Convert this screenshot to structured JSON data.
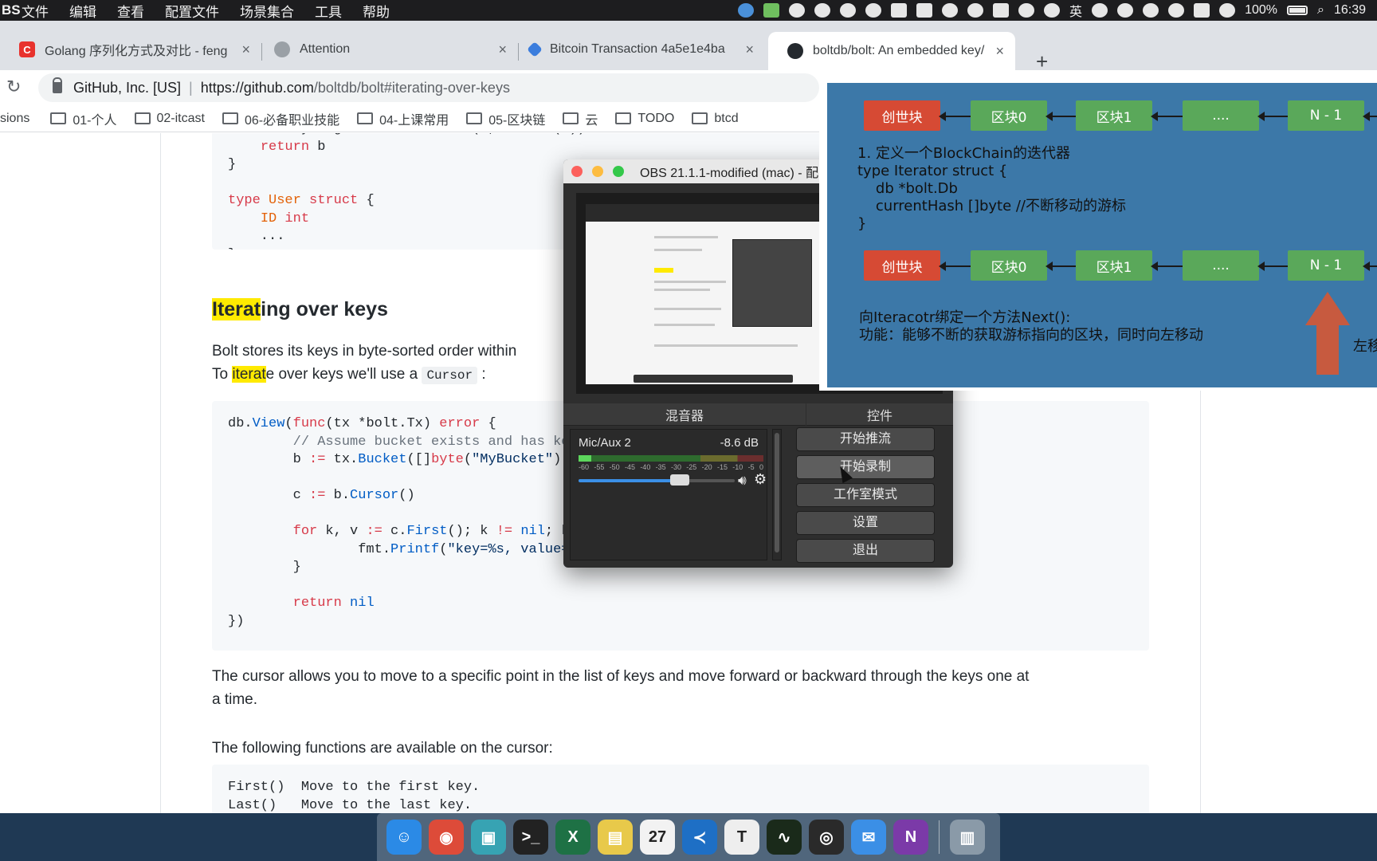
{
  "menubar": {
    "app_name": "BS",
    "menus": [
      "文件",
      "编辑",
      "查看",
      "配置文件",
      "场景集合",
      "工具",
      "帮助"
    ],
    "battery": "100%",
    "ime": "英",
    "clock": "16:39"
  },
  "tabs": [
    {
      "title": "Golang 序列化方式及对比 - feng",
      "favicon": "C",
      "favicon_color": "#e8322d"
    },
    {
      "title": "Attention",
      "favicon": "",
      "favicon_color": "#9aa0a6"
    },
    {
      "title": "Bitcoin Transaction 4a5e1e4ba",
      "favicon": "",
      "favicon_color": "#3b7ddd"
    },
    {
      "title": "boltdb/bolt: An embedded key/",
      "favicon": "",
      "favicon_color": "#24292e"
    }
  ],
  "address": {
    "org": "GitHub, Inc. [US]",
    "host": "https://github.com",
    "path": "/boltdb/bolt#iterating-over-keys"
  },
  "bookmarks": [
    "sions",
    "01-个人",
    "02-itcast",
    "06-必备职业技能",
    "04-上课常用",
    "05-区块链",
    "云",
    "TODO",
    "btcd"
  ],
  "page": {
    "heading_hl": "Iterat",
    "heading_rest": "ing over keys",
    "intro_line1": "Bolt stores its keys in byte-sorted order within",
    "intro_line2_pre": "To ",
    "intro_line2_hl": "iterat",
    "intro_line2_post": "e over keys we'll use a",
    "intro_code": "Cursor",
    "intro_tail": ":",
    "cursor_para_l1": "The cursor allows you to move to a specific point in the list of keys and move forward or backward through the keys one at",
    "cursor_para_l2": "a time.",
    "functions_para": "The following functions are available on the cursor:",
    "fn1": "First()  Move to the first key.",
    "fn2": "Last()   Move to the last key."
  },
  "obs": {
    "title": "OBS 21.1.1-modified (mac) - 配",
    "mixer_label": "混音器",
    "controls_label": "控件",
    "source_name": "Mic/Aux 2",
    "source_db": "-8.6 dB",
    "meter_level": 0.07,
    "volume_level": 0.65,
    "ticks": [
      "-60",
      "-55",
      "-50",
      "-45",
      "-40",
      "-35",
      "-30",
      "-25",
      "-20",
      "-15",
      "-10",
      "-5",
      "0"
    ],
    "buttons": [
      "开始推流",
      "开始录制",
      "工作室模式",
      "设置",
      "退出"
    ]
  },
  "slide": {
    "row1": [
      "创世块",
      "区块0",
      "区块1",
      "....",
      "N - 1"
    ],
    "row2": [
      "创世块",
      "区块0",
      "区块1",
      "....",
      "N - 1"
    ],
    "def_text": "1. 定义一个BlockChain的迭代器\ntype Iterator struct {\n    db *bolt.Db\n    currentHash []byte //不断移动的游标\n}",
    "next_text": "向Iteracotr绑定一个方法Next():\n功能：能够不断的获取游标指向的区块，同时向左移动",
    "side_text": "左移"
  },
  "dock": [
    {
      "name": "Finder",
      "color": "#2b8ae6",
      "glyph": "☺"
    },
    {
      "name": "Chrome",
      "color": "#dd4b39",
      "glyph": "◉"
    },
    {
      "name": "Preview",
      "color": "#37a3b3",
      "glyph": "▣"
    },
    {
      "name": "Terminal",
      "color": "#222222",
      "glyph": ">_"
    },
    {
      "name": "Excel",
      "color": "#1e7145",
      "glyph": "X"
    },
    {
      "name": "Stickies",
      "color": "#e8c94a",
      "glyph": "▤"
    },
    {
      "name": "Calendar",
      "color": "#f2f2f2",
      "glyph": "27"
    },
    {
      "name": "VS Code",
      "color": "#1e6fc5",
      "glyph": "≺"
    },
    {
      "name": "Typora",
      "color": "#eeeeee",
      "glyph": "T"
    },
    {
      "name": "Activity Monitor",
      "color": "#1a2a1a",
      "glyph": "∿"
    },
    {
      "name": "OBS",
      "color": "#2a2a2a",
      "glyph": "◎"
    },
    {
      "name": "Messages",
      "color": "#3b8fe6",
      "glyph": "✉"
    },
    {
      "name": "OneNote",
      "color": "#7b3aa8",
      "glyph": "N"
    },
    {
      "name": "Trash",
      "color": "#8a9aa8",
      "glyph": "▥"
    }
  ]
}
